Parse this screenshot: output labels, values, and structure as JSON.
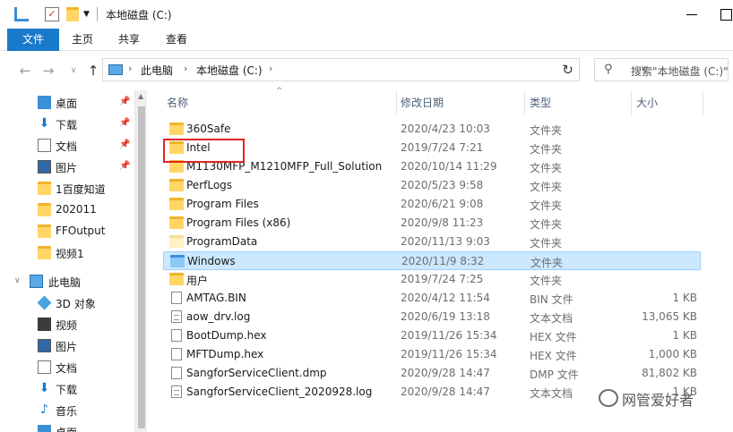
{
  "window": {
    "title": "本地磁盘 (C:)"
  },
  "ribbon": {
    "tabs": [
      "文件",
      "主页",
      "共享",
      "查看"
    ]
  },
  "address": {
    "crumbs": [
      "此电脑",
      "本地磁盘 (C:)"
    ],
    "search_placeholder": "搜索\"本地磁盘 (C:)\""
  },
  "sidebar": {
    "items": [
      {
        "label": "桌面",
        "icon": "desktop-icon",
        "pinned": true
      },
      {
        "label": "下载",
        "icon": "download-icon",
        "pinned": true
      },
      {
        "label": "文档",
        "icon": "document-icon",
        "pinned": true
      },
      {
        "label": "图片",
        "icon": "picture-icon",
        "pinned": true
      },
      {
        "label": "1百度知道",
        "icon": "folder-icon",
        "pinned": false
      },
      {
        "label": "202011",
        "icon": "folder-icon",
        "pinned": false
      },
      {
        "label": "FFOutput",
        "icon": "folder-icon",
        "pinned": false
      },
      {
        "label": "视频1",
        "icon": "folder-icon",
        "pinned": false
      },
      {
        "label": "此电脑",
        "icon": "pc-icon",
        "pinned": false
      },
      {
        "label": "3D 对象",
        "icon": "3d-objects-icon",
        "pinned": false
      },
      {
        "label": "视频",
        "icon": "video-icon",
        "pinned": false
      },
      {
        "label": "图片",
        "icon": "picture-icon",
        "pinned": false
      },
      {
        "label": "文档",
        "icon": "document-icon",
        "pinned": false
      },
      {
        "label": "下载",
        "icon": "download-icon",
        "pinned": false
      },
      {
        "label": "音乐",
        "icon": "music-icon",
        "pinned": false
      },
      {
        "label": "桌面",
        "icon": "desktop-icon",
        "pinned": false
      }
    ]
  },
  "columns": {
    "name": "名称",
    "date": "修改日期",
    "type": "类型",
    "size": "大小"
  },
  "files": [
    {
      "name": "360Safe",
      "date": "2020/4/23 10:03",
      "type": "文件夹",
      "size": "",
      "kind": "folder"
    },
    {
      "name": "Intel",
      "date": "2019/7/24 7:21",
      "type": "文件夹",
      "size": "",
      "kind": "folder"
    },
    {
      "name": "M1130MFP_M1210MFP_Full_Solution",
      "date": "2020/10/14 11:29",
      "type": "文件夹",
      "size": "",
      "kind": "folder"
    },
    {
      "name": "PerfLogs",
      "date": "2020/5/23 9:58",
      "type": "文件夹",
      "size": "",
      "kind": "folder"
    },
    {
      "name": "Program Files",
      "date": "2020/6/21 9:08",
      "type": "文件夹",
      "size": "",
      "kind": "folder"
    },
    {
      "name": "Program Files (x86)",
      "date": "2020/9/8 11:23",
      "type": "文件夹",
      "size": "",
      "kind": "folder"
    },
    {
      "name": "ProgramData",
      "date": "2020/11/13 9:03",
      "type": "文件夹",
      "size": "",
      "kind": "folder-hidden"
    },
    {
      "name": "Windows",
      "date": "2020/11/9 8:32",
      "type": "文件夹",
      "size": "",
      "kind": "folder"
    },
    {
      "name": "用户",
      "date": "2019/7/24 7:25",
      "type": "文件夹",
      "size": "",
      "kind": "folder"
    },
    {
      "name": "AMTAG.BIN",
      "date": "2020/4/12 11:54",
      "type": "BIN 文件",
      "size": "1 KB",
      "kind": "file"
    },
    {
      "name": "aow_drv.log",
      "date": "2020/6/19 13:18",
      "type": "文本文档",
      "size": "13,065 KB",
      "kind": "text"
    },
    {
      "name": "BootDump.hex",
      "date": "2019/11/26 15:34",
      "type": "HEX 文件",
      "size": "1 KB",
      "kind": "file"
    },
    {
      "name": "MFTDump.hex",
      "date": "2019/11/26 15:34",
      "type": "HEX 文件",
      "size": "1,000 KB",
      "kind": "file"
    },
    {
      "name": "SangforServiceClient.dmp",
      "date": "2020/9/28 14:47",
      "type": "DMP 文件",
      "size": "81,802 KB",
      "kind": "file"
    },
    {
      "name": "SangforServiceClient_2020928.log",
      "date": "2020/9/28 14:47",
      "type": "文本文档",
      "size": "1 KB",
      "kind": "text"
    }
  ],
  "watermark": {
    "text": "网管爱好者"
  }
}
